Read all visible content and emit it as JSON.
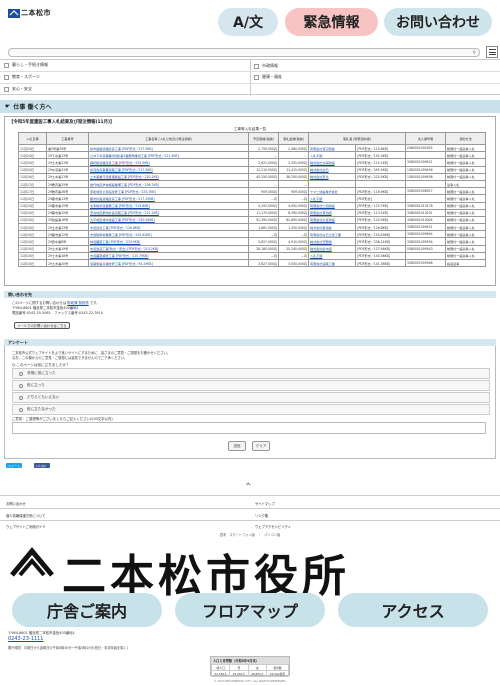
{
  "header": {
    "logo_text": "二本松市",
    "lang_btn": "A/文",
    "emergency_btn": "緊急情報",
    "contact_btn": "お問い合わせ"
  },
  "nav": {
    "items": [
      {
        "label": "暮らし・手続き情報"
      },
      {
        "label": "市政情報"
      },
      {
        "label": "教育・スポーツ"
      },
      {
        "label": "健康・福祉"
      },
      {
        "label": "安心・安全"
      }
    ]
  },
  "page": {
    "section_title": "仕事 働く方へ",
    "panel_title": "【令和5年度建設工事入札結果及び発注情報(11月)】",
    "table_caption": "工事等入札結果一覧"
  },
  "table": {
    "headers": [
      "入札日等",
      "工事番号",
      "工事名等\n(入札公告及び発注情報)",
      "予定価格(税抜)",
      "落札金額(税抜)",
      "落札者\n(随意契約者)",
      "法人番号等",
      "契約方法"
    ],
    "rows": [
      [
        "11月24日",
        "第5号第29号",
        "県市連絡道路改良工事 [PDF形式／227.5KB]",
        "2,750,000円",
        "2,480,000円",
        "有限会社渡辺建設",
        "[PDF形式／115.6KB]",
        "2380001001625",
        "制限付一般競争入札"
      ],
      [
        "11月24日",
        "29下水第13号",
        "公共下水道事業(管梁)第2整備局維持工事 [PDF形式／221.3KB]",
        "－",
        "－",
        "入札不調",
        "[PDF形式／101.0KB]",
        "",
        "制限付一般競争入札"
      ],
      [
        "11月24日",
        "29土木第21号",
        "森町線道路改良工事 [PDF形式／233.5KB]",
        "2,621,000円",
        "2,355,000円",
        "株式会社太陽建設",
        "[PDF形式／115.1KB]",
        "3380001009421",
        "制限付一般競争入札"
      ],
      [
        "11月24日",
        "29水道第31号",
        "県道改良事業道路工事 [PDF形式／217.5KB]",
        "12,210,000円",
        "11,415,000円",
        "株式会社白石",
        "[PDF形式／255.5KB]",
        "1380001009456",
        "制限付一般競争入札"
      ],
      [
        "11月24日",
        "29土木第21号",
        "土木事業汚泥処理施設工事 [PDF形式／220.2KB]",
        "45,250,000円",
        "38,200,000円",
        "株式会社東北",
        "[PDF形式／225.5KB]",
        "1380001009456",
        "制限付一般競争入札"
      ],
      [
        "11月17日",
        "29教育第25号",
        "岩代地区学校施設整備工事 [PDF形式／106.7KB]",
        "－",
        "－",
        "",
        "",
        "",
        "競争入札"
      ],
      [
        "11月17日",
        "29教育第26号",
        "東和地区公民館改修工事 [PDF形式／233.7KB]",
        "909,000円",
        "909,000円",
        "ヤマ二建設株式会社",
        "[PDF形式／116.9KB]",
        "3380001008927",
        "制限付一般競争入札"
      ],
      [
        "11月10日",
        "29都市第13号",
        "都市計画道路改良工事 [PDF形式／217.25KB]",
        "－円",
        "－円",
        "入札不調",
        "[PDF形式]",
        "",
        "制限付一般競争入札"
      ],
      [
        "11月10日",
        "29都市第15号",
        "北条線歩道整備工事 [PDF形式／215.8KB]",
        "4,252,000円",
        "4,000,000円",
        "有限会社仁和建設",
        "[PDF形式／125.7KB]",
        "3380001013178",
        "制限付一般競争入札"
      ],
      [
        "11月10日",
        "29都市第15号",
        "安達地区都市計画道路工事 [PDF形式／221.2KB]",
        "11,175,000円",
        "8,390,000円",
        "有限会社菊池組",
        "[PDF形式／113.1KB]",
        "3380001013251",
        "制限付一般競争入札"
      ],
      [
        "11月10日",
        "29建設第16号",
        "大平地区排水施設工事 [PDF形式／230.94KB]",
        "92,390,000円",
        "82,890,000円",
        "有限会社丸合建設",
        "[PDF形式／120.5KB]",
        "3380001010004",
        "制限付一般競争入札"
      ],
      [
        "11月10日",
        "29土木第23号",
        "市道改良工事 [PDF形式／126.8KB]",
        "1,861,000円",
        "1,200,000円",
        "株式会社星建設",
        "[PDF形式／126.8KB]",
        "3380001009421",
        "制限付一般競争入札"
      ],
      [
        "11月10日",
        "29都市第12号",
        "市営駐車場整備工事 [PDF形式／220.62KB]",
        "－円",
        "－円",
        "有限会社白石土建工業",
        "[PDF形式／154.49KB]",
        "3380001009644",
        "制限付一般競争入札"
      ],
      [
        "11月10日",
        "29農水第8号",
        "林道舗装工事 [PDF形式／233.9KB]",
        "5,827,000円",
        "4,910,000円",
        "株式会社菅野組",
        "[PDF形式／236.21KB]",
        "3380001009554",
        "制限付一般競争入札"
      ],
      [
        "11月10日",
        "29土木第19号",
        "市道改良工事(防災・安全) [PDF形式／213.2KB]",
        "28,180,000円",
        "25,240,000円",
        "株式会社鈴木組",
        "[PDF形式／127.46KB]",
        "5380001009543",
        "制限付一般競争入札"
      ],
      [
        "11月10日",
        "29土木第18号",
        "市道舗装補修工事 [PDF形式／215.79KB]",
        "－円",
        "－円",
        "入札不調",
        "[PDF形式／140.36KB]",
        "",
        "制限付一般競争入札"
      ],
      [
        "11月10日",
        "29土木第20号",
        "道路施設点検改修工事 [PDF形式／94.29KB]",
        "3,627,000円",
        "3,000,000円",
        "有限会社遠藤工業",
        "[PDF形式／141.58KB]",
        "3380001009348",
        "指名競争"
      ]
    ]
  },
  "contact": {
    "heading": "問い合わせ先",
    "line1_prefix": "このページに関するお問い合わせは ",
    "line1_link": "財政課 契約係",
    "line1_suffix": " です。",
    "line2": "〒964-8601 福島県二本松市金色403番地1",
    "line3": "電話番号:0243-55-5061　ファックス番号:0243-22-7610",
    "mail_btn": "メールでのお問い合わせはこちら"
  },
  "survey": {
    "heading": "アンケート",
    "intro1": "二本松市公式ウェブサイトをより良いサイトにするために、皆さまのご意見・ご感想をお聞かせください。",
    "intro2": "なお、この欄からのご意見・ご感想には返答できませんのでご了承ください。",
    "q1": "Q.このページは役に立ちましたか？",
    "options": [
      "非常に役に立った",
      "役に立った",
      "どちらともいえない",
      "役に立たなかった"
    ],
    "q2": "ご意見・ご感想等がございましたらご記入ください(200文字以内)",
    "send_btn": "送信",
    "clear_btn": "クリア"
  },
  "share": {
    "tweet": "ツイート",
    "like": "いいね！"
  },
  "footer_links": {
    "left": [
      "お問い合わせ",
      "個人情報保護方針について",
      "ウェブサイトご利用ガイド"
    ],
    "right": [
      "サイトマップ",
      "リンク集",
      "ウェブアクセシビリティ"
    ]
  },
  "footer_nav": "週末　スマートフォン版　｜　パソコン版",
  "footer": {
    "big_name": "二本松市役所",
    "pill1": "庁舎ご案内",
    "pill2": "フロアマップ",
    "pill3": "アクセス",
    "address": "〒964-8601 福島県二本松市金色403番地1",
    "phone": "0243-23-1111",
    "hours": "開庁時間：月曜日から金曜日の午前8時30分～午後5時15分(祝日・年末年始を除く)",
    "pop_title": "人口と世帯数（令和5年9月末）",
    "pop_row1": [
      "総人口",
      "男",
      "女",
      "世帯数"
    ],
    "pop_row2": [
      "52,556人",
      "25,901人",
      "26,655人",
      "22,062世帯"
    ],
    "copyright": "© 2023 NIHONMATSU CITY, ALL RIGHTS RESERVED."
  },
  "colors": {
    "emergency": "#f7c3c3",
    "accent": "#c8e2ea",
    "link": "#1a4fa3"
  }
}
